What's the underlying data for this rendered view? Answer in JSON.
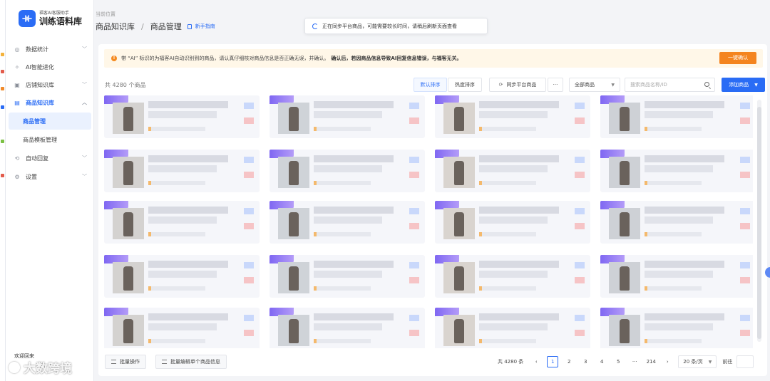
{
  "app": {
    "subtitle": "福客AI客服助手",
    "name": "训练语料库"
  },
  "sidebar": {
    "items": [
      {
        "label": "数据统计",
        "icon": "chart-icon"
      },
      {
        "label": "AI智能进化",
        "icon": "sparkle-icon"
      },
      {
        "label": "店铺知识库",
        "icon": "store-icon"
      },
      {
        "label": "商品知识库",
        "icon": "box-icon"
      },
      {
        "label": "商品管理"
      },
      {
        "label": "商品模板管理"
      },
      {
        "label": "自动回复",
        "icon": "reply-icon"
      },
      {
        "label": "设置",
        "icon": "settings-icon"
      }
    ],
    "bottom_label": "欢迎回来"
  },
  "header": {
    "location_label": "当前位置",
    "crumb_parent": "商品知识库",
    "crumb_separator": "/",
    "crumb_current": "商品管理",
    "guide_label": "新手指南"
  },
  "toast": {
    "text": "正在同步平台商品，可能需要较长时间，请稍后刷新页面查看"
  },
  "notice": {
    "text": "带 “AI” 标识的为福客AI自动识别到的商品，请认真仔细核对商品信息是否正确无误，并确认。",
    "bold": "确认后，若因商品信息导致AI回复信息错误，与福客无关。",
    "button": "一键确认"
  },
  "toolbar": {
    "count": "共 4280 个商品",
    "sort_default": "默认排序",
    "sort_hot": "热度排序",
    "sync": "同步平台商品",
    "more": "···",
    "filter": "全部商品",
    "search_placeholder": "搜索商品名称/ID",
    "add": "添加商品"
  },
  "footer": {
    "batch_op": "批量操作",
    "batch_edit": "批量编辑单个商品信息",
    "total": "共 4280 条",
    "prev": "‹",
    "pages": [
      "1",
      "2",
      "3",
      "4",
      "5",
      "···",
      "214"
    ],
    "next": "›",
    "page_size": "20 条/页",
    "goto": "前往"
  },
  "watermark": "大数跨境",
  "colors": {
    "primary": "#2a6cf5",
    "warning": "#f4841f",
    "notice_bg": "#fff7e8",
    "ai_tag": "#7f67f2"
  }
}
